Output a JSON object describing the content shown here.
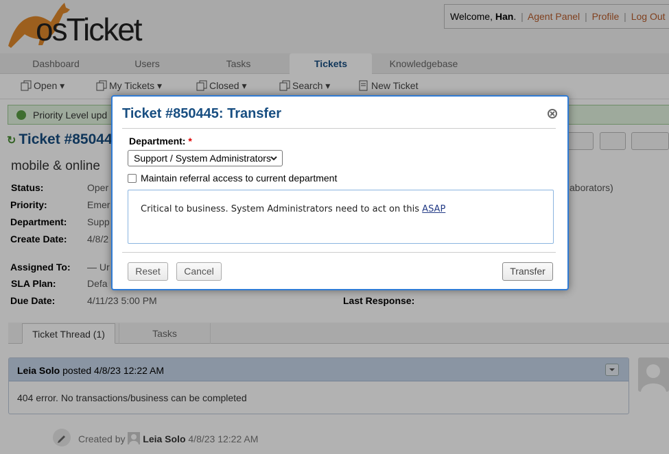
{
  "header": {
    "logo_text": "osTicket",
    "welcome_prefix": "Welcome, ",
    "user_name": "Han",
    "welcome_suffix": ".",
    "links": {
      "agent_panel": "Agent Panel",
      "profile": "Profile",
      "logout": "Log Out"
    }
  },
  "nav": {
    "tabs": [
      "Dashboard",
      "Users",
      "Tasks",
      "Tickets",
      "Knowledgebase"
    ],
    "active": "Tickets"
  },
  "subnav": {
    "items": [
      "Open",
      "My Tickets",
      "Closed",
      "Search",
      "New Ticket"
    ]
  },
  "notice": {
    "text": "Priority Level upd"
  },
  "ticket": {
    "title": "Ticket #85044",
    "subject": "mobile & online",
    "fields": {
      "status_label": "Status:",
      "status_value": "Oper",
      "priority_label": "Priority:",
      "priority_value": "Emer",
      "department_label": "Department:",
      "department_value": "Supp",
      "create_date_label": "Create Date:",
      "create_date_value": "4/8/2",
      "assigned_label": "Assigned To:",
      "assigned_value": "— Ur",
      "sla_label": "SLA Plan:",
      "sla_value": "Defa",
      "due_label": "Due Date:",
      "due_value": "4/11/23 5:00 PM",
      "last_response_label": "Last Response:",
      "collaborators_fragment": "aborators)"
    }
  },
  "thread": {
    "tabs": [
      "Ticket Thread (1)",
      "Tasks"
    ],
    "entry": {
      "author": "Leia Solo",
      "posted": " posted 4/8/23 12:22 AM",
      "body": "404 error. No transactions/business can be completed"
    },
    "event": {
      "prefix": "Created by ",
      "author": "Leia Solo",
      "time": " 4/8/23 12:22 AM"
    }
  },
  "dialog": {
    "title": "Ticket #850445: Transfer",
    "department_label": "Department:",
    "required_mark": "*",
    "department_selected": "Support / System Administrators",
    "maintain_referral_label": "Maintain referral access to current department",
    "maintain_referral_checked": false,
    "comment_text": "Critical to business. System Administrators need to act on this ",
    "comment_link": "ASAP",
    "buttons": {
      "reset": "Reset",
      "cancel": "Cancel",
      "transfer": "Transfer"
    }
  },
  "colors": {
    "brand_blue": "#184e81",
    "dialog_border": "#2f7bd5",
    "link_orange": "#b85c2c",
    "thread_header": "#c6d6ea",
    "notice_green": "#e3f4e0",
    "logo_orange": "#e0892b"
  },
  "icons": {
    "logo": "kangaroo-logo",
    "subnav": "copy-icon",
    "new_ticket": "document-icon",
    "close": "close-circle-icon",
    "refresh": "refresh-icon",
    "notice": "check-circle-icon"
  }
}
